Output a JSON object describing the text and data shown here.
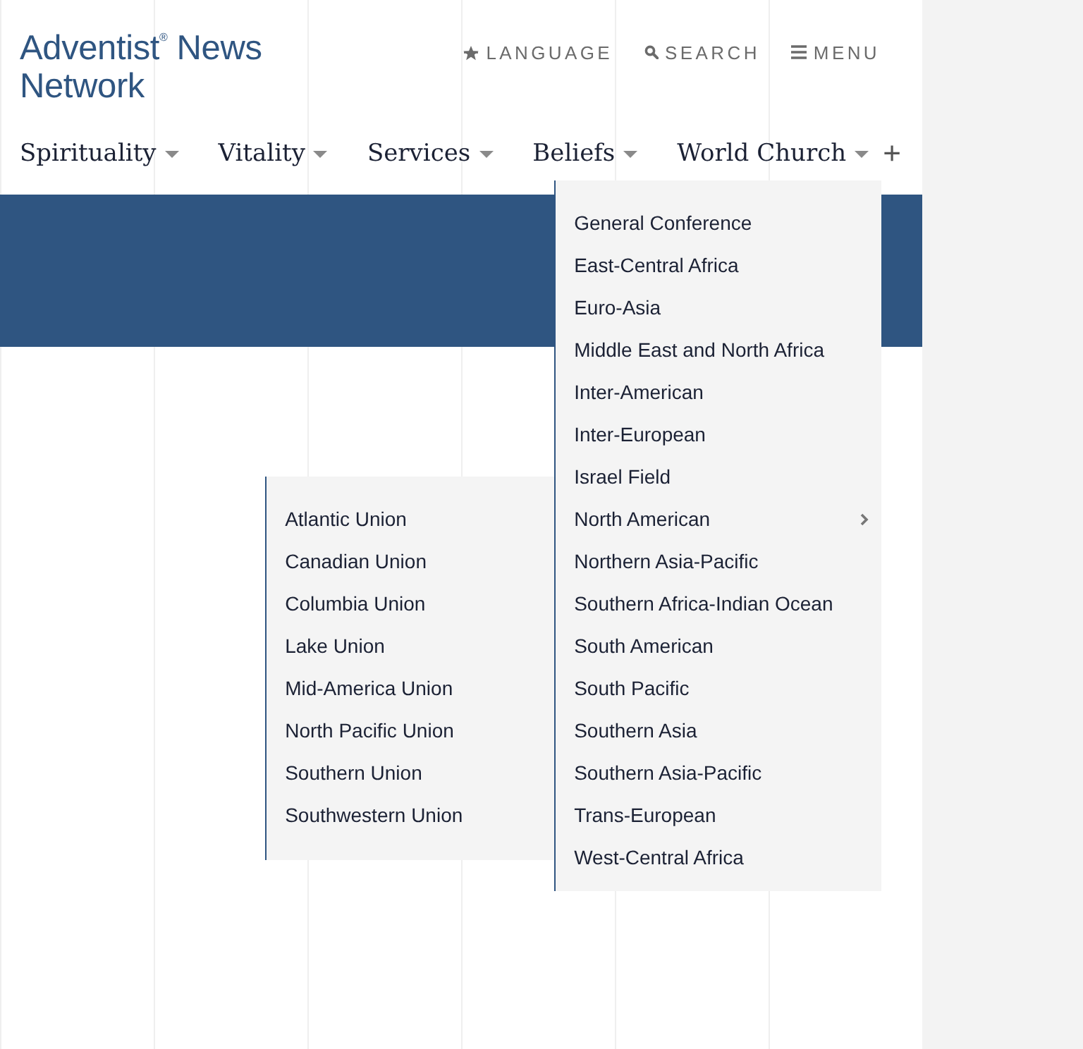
{
  "logo": "Adventist$^{®}$ News Network",
  "utility_nav": [
    {
      "kind": "language",
      "label": "LANGUAGE"
    },
    {
      "kind": "search",
      "label": "SEARCH"
    },
    {
      "kind": "menu",
      "label": "MENU"
    }
  ],
  "main_nav": {
    "items": [
      {
        "label": "Spirituality"
      },
      {
        "label": "Vitality"
      },
      {
        "label": "Services"
      },
      {
        "label": "Beliefs"
      },
      {
        "label": "World Church",
        "children": [
          {
            "label": "General Conference"
          },
          {
            "label": "East-Central Africa"
          },
          {
            "label": "Euro-Asia"
          },
          {
            "label": "Middle East and North Africa"
          },
          {
            "label": "Inter-American"
          },
          {
            "label": "Inter-European"
          },
          {
            "label": "Israel Field"
          },
          {
            "label": "North American",
            "children": [
              {
                "label": "Atlantic Union"
              },
              {
                "label": "Canadian Union"
              },
              {
                "label": "Columbia Union"
              },
              {
                "label": "Lake Union"
              },
              {
                "label": "Mid-America Union"
              },
              {
                "label": "North Pacific Union"
              },
              {
                "label": "Southern Union"
              },
              {
                "label": "Southwestern Union"
              }
            ]
          },
          {
            "label": "Northern Asia-Pacific"
          },
          {
            "label": "Southern Africa-Indian Ocean"
          },
          {
            "label": "South American"
          },
          {
            "label": "South Pacific"
          },
          {
            "label": "Southern Asia"
          },
          {
            "label": "Southern Asia-Pacific"
          },
          {
            "label": "Trans-European"
          },
          {
            "label": "West-Central Africa"
          }
        ]
      }
    ],
    "more_button": "+"
  }
}
